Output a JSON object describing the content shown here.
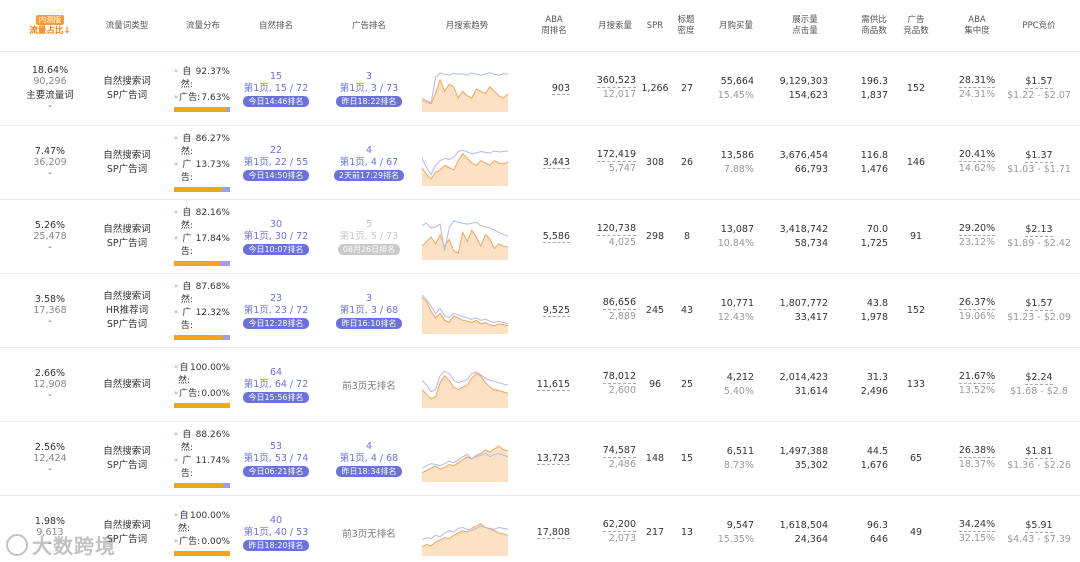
{
  "headers": {
    "share_badge": "内测版",
    "share": "流量占比",
    "share_arrow": "↓",
    "kwtype": "流量词类型",
    "dist": "流量分布",
    "organic_rank": "自然排名",
    "ad_rank": "广告排名",
    "trend": "月搜索趋势",
    "aba_rank": [
      "ABA",
      "周排名"
    ],
    "monthly_search": "月搜索量",
    "spr": "SPR",
    "title_density": [
      "标题",
      "密度"
    ],
    "monthly_buy": "月购买量",
    "impr_click": [
      "展示量",
      "点击量"
    ],
    "supply_demand": [
      "需供比",
      "商品数"
    ],
    "ad_products": [
      "广告",
      "竞品数"
    ],
    "aba_conc": [
      "ABA",
      "集中度"
    ],
    "ppc": "PPC竞价"
  },
  "labels": {
    "organic": "自然:",
    "ad": "广告:"
  },
  "rows": [
    {
      "share_pct": "18.64%",
      "share_num": "90,296",
      "share_note": "主要流量词",
      "share_dash": "-",
      "types": [
        "自然搜索词",
        "SP广告词"
      ],
      "organic_pct": "92.37%",
      "ad_pct": "7.63%",
      "organic_frac": 0.9237,
      "org_top": "15",
      "org_mid": "第1页, 15 / 72",
      "org_tag": "今日14:46排名",
      "ad_top": "3",
      "ad_mid": "第1页, 3 / 73",
      "ad_tag": "昨日18:22排名",
      "ad_state": "active",
      "aba": "903",
      "search_a": "360,523",
      "search_b": "12,017",
      "spr": "1,266",
      "density": "27",
      "buy_a": "55,664",
      "buy_b": "15.45%",
      "impr": "9,129,303",
      "click": "154,623",
      "ratio": "196.3",
      "products": "1,837",
      "adprod": "152",
      "conc_a": "28.31%",
      "conc_b": "24.31%",
      "ppc_a": "$1.57",
      "ppc_b": "$1.22 - $2.07",
      "spark_o": [
        25,
        22,
        18,
        40,
        70,
        45,
        60,
        55,
        30,
        45,
        35,
        30,
        50,
        45,
        40,
        55,
        45,
        35,
        30,
        40
      ],
      "spark_p": [
        30,
        25,
        20,
        75,
        85,
        82,
        80,
        84,
        82,
        83,
        80,
        85,
        82,
        80,
        83,
        85,
        82,
        80,
        84,
        82
      ]
    },
    {
      "share_pct": "7.47%",
      "share_num": "36,209",
      "share_note": "",
      "share_dash": "-",
      "types": [
        "自然搜索词",
        "SP广告词"
      ],
      "organic_pct": "86.27%",
      "ad_pct": "13.73%",
      "organic_frac": 0.8627,
      "org_top": "22",
      "org_mid": "第1页, 22 / 55",
      "org_tag": "今日14:50排名",
      "ad_top": "4",
      "ad_mid": "第1页, 4 / 67",
      "ad_tag": "2天前17:29排名",
      "ad_state": "active",
      "aba": "3,443",
      "search_a": "172,419",
      "search_b": "5,747",
      "spr": "308",
      "density": "26",
      "buy_a": "13,586",
      "buy_b": "7.88%",
      "impr": "3,676,454",
      "click": "66,793",
      "ratio": "116.8",
      "products": "1,476",
      "adprod": "146",
      "conc_a": "20.41%",
      "conc_b": "14.62%",
      "ppc_a": "$1.37",
      "ppc_b": "$1.03 - $1.71",
      "spark_o": [
        40,
        25,
        15,
        30,
        35,
        45,
        40,
        35,
        55,
        70,
        60,
        50,
        45,
        55,
        50,
        45,
        55,
        50,
        48,
        52
      ],
      "spark_p": [
        60,
        40,
        25,
        45,
        55,
        60,
        58,
        62,
        75,
        78,
        74,
        70,
        72,
        75,
        73,
        72,
        76,
        74,
        75,
        76
      ]
    },
    {
      "share_pct": "5.26%",
      "share_num": "25,478",
      "share_note": "",
      "share_dash": "-",
      "types": [
        "自然搜索词",
        "SP广告词"
      ],
      "organic_pct": "82.16%",
      "ad_pct": "17.84%",
      "organic_frac": 0.8216,
      "org_top": "30",
      "org_mid": "第1页, 30 / 72",
      "org_tag": "今日10:07排名",
      "ad_top": "5",
      "ad_mid": "第1页, 5 / 73",
      "ad_tag": "08月26日排名",
      "ad_state": "stale",
      "aba": "5,586",
      "search_a": "120,738",
      "search_b": "4,025",
      "spr": "298",
      "density": "8",
      "buy_a": "13,087",
      "buy_b": "10.84%",
      "impr": "3,418,742",
      "click": "58,734",
      "ratio": "70.0",
      "products": "1,725",
      "adprod": "91",
      "conc_a": "29.20%",
      "conc_b": "23.12%",
      "ppc_a": "$2.13",
      "ppc_b": "$1.89 - $2.42",
      "spark_o": [
        30,
        40,
        50,
        35,
        55,
        30,
        45,
        20,
        15,
        60,
        40,
        65,
        50,
        30,
        55,
        45,
        25,
        35,
        30,
        28
      ],
      "spark_p": [
        75,
        80,
        70,
        72,
        78,
        20,
        70,
        85,
        82,
        80,
        78,
        80,
        82,
        75,
        72,
        70,
        65,
        60,
        55,
        52
      ]
    },
    {
      "share_pct": "3.58%",
      "share_num": "17,368",
      "share_note": "",
      "share_dash": "-",
      "types": [
        "自然搜索词",
        "HR推荐词",
        "SP广告词"
      ],
      "organic_pct": "87.68%",
      "ad_pct": "12.32%",
      "organic_frac": 0.8768,
      "org_top": "23",
      "org_mid": "第1页, 23 / 72",
      "org_tag": "今日12:28排名",
      "ad_top": "3",
      "ad_mid": "第1页, 3 / 68",
      "ad_tag": "昨日16:10排名",
      "ad_state": "active",
      "aba": "9,525",
      "search_a": "86,656",
      "search_b": "2,889",
      "spr": "245",
      "density": "43",
      "buy_a": "10,771",
      "buy_b": "12.43%",
      "impr": "1,807,772",
      "click": "33,417",
      "ratio": "43.8",
      "products": "1,978",
      "adprod": "152",
      "conc_a": "26.37%",
      "conc_b": "19.06%",
      "ppc_a": "$1.57",
      "ppc_b": "$1.23 - $2.09",
      "spark_o": [
        80,
        70,
        50,
        35,
        45,
        30,
        25,
        40,
        35,
        30,
        28,
        25,
        30,
        22,
        25,
        20,
        18,
        22,
        20,
        18
      ],
      "spark_p": [
        85,
        75,
        60,
        45,
        55,
        40,
        35,
        45,
        42,
        38,
        35,
        32,
        35,
        30,
        32,
        28,
        25,
        28,
        25,
        22
      ]
    },
    {
      "share_pct": "2.66%",
      "share_num": "12,908",
      "share_note": "",
      "share_dash": "-",
      "types": [
        "自然搜索词"
      ],
      "organic_pct": "100.00%",
      "ad_pct": "0.00%",
      "organic_frac": 1.0,
      "org_top": "64",
      "org_mid": "第1页, 64 / 72",
      "org_tag": "今日15:56排名",
      "ad_state": "none",
      "ad_none": "前3页无排名",
      "aba": "11,615",
      "search_a": "78,012",
      "search_b": "2,600",
      "spr": "96",
      "density": "25",
      "buy_a": "4,212",
      "buy_b": "5.40%",
      "impr": "2,014,423",
      "click": "31,614",
      "ratio": "31.3",
      "products": "2,496",
      "adprod": "133",
      "conc_a": "21.67%",
      "conc_b": "13.52%",
      "ppc_a": "$2.24",
      "ppc_b": "$1.68 - $2.8",
      "spark_o": [
        40,
        30,
        20,
        25,
        55,
        70,
        60,
        45,
        40,
        45,
        50,
        65,
        75,
        70,
        55,
        45,
        40,
        38,
        35,
        32
      ],
      "spark_p": [
        60,
        50,
        35,
        40,
        70,
        80,
        75,
        60,
        55,
        58,
        62,
        75,
        78,
        72,
        65,
        60,
        58,
        55,
        52,
        50
      ]
    },
    {
      "share_pct": "2.56%",
      "share_num": "12,424",
      "share_note": "",
      "share_dash": "-",
      "types": [
        "自然搜索词",
        "SP广告词"
      ],
      "organic_pct": "88.26%",
      "ad_pct": "11.74%",
      "organic_frac": 0.8826,
      "org_top": "53",
      "org_mid": "第1页, 53 / 74",
      "org_tag": "今日06:21排名",
      "ad_top": "4",
      "ad_mid": "第1页, 4 / 68",
      "ad_tag": "昨日18:34排名",
      "ad_state": "active",
      "aba": "13,723",
      "search_a": "74,587",
      "search_b": "2,486",
      "spr": "148",
      "density": "15",
      "buy_a": "6,511",
      "buy_b": "8.73%",
      "impr": "1,497,388",
      "click": "35,302",
      "ratio": "44.5",
      "products": "1,676",
      "adprod": "65",
      "conc_a": "26.38%",
      "conc_b": "18.37%",
      "ppc_a": "$1.81",
      "ppc_b": "$1.36 - $2.26",
      "spark_o": [
        20,
        25,
        30,
        35,
        28,
        32,
        38,
        35,
        42,
        48,
        55,
        50,
        58,
        62,
        70,
        65,
        72,
        78,
        70,
        68
      ],
      "spark_p": [
        30,
        35,
        40,
        38,
        35,
        40,
        45,
        42,
        48,
        55,
        60,
        50,
        55,
        58,
        62,
        55,
        60,
        62,
        58,
        55
      ]
    },
    {
      "share_pct": "1.98%",
      "share_num": "9,613",
      "share_note": "",
      "share_dash": "-",
      "types": [
        "自然搜索词",
        "SP广告词"
      ],
      "organic_pct": "100.00%",
      "ad_pct": "0.00%",
      "organic_frac": 1.0,
      "org_top": "40",
      "org_mid": "第1页, 40 / 53",
      "org_tag": "昨日18:20排名",
      "ad_state": "none",
      "ad_none": "前3页无排名",
      "aba": "17,808",
      "search_a": "62,200",
      "search_b": "2,073",
      "spr": "217",
      "density": "13",
      "buy_a": "9,547",
      "buy_b": "15.35%",
      "impr": "1,618,504",
      "click": "24,364",
      "ratio": "96.3",
      "products": "646",
      "adprod": "49",
      "conc_a": "34.24%",
      "conc_b": "32.15%",
      "ppc_a": "$5.91",
      "ppc_b": "$4.43 - $7.39",
      "spark_o": [
        20,
        25,
        22,
        30,
        35,
        40,
        38,
        45,
        50,
        55,
        52,
        60,
        65,
        70,
        62,
        58,
        55,
        50,
        48,
        45
      ],
      "spark_p": [
        35,
        40,
        38,
        45,
        42,
        50,
        55,
        52,
        60,
        62,
        58,
        55,
        60,
        65,
        62,
        60,
        58,
        62,
        60,
        58
      ]
    }
  ],
  "watermark": "大数跨境",
  "colors": {
    "accent": "#6a72d9",
    "orange": "#fba21b",
    "spark_fill": "#fde1c4",
    "spark_line": "#f7a35c",
    "spark_purple": "#b3b8ef"
  }
}
